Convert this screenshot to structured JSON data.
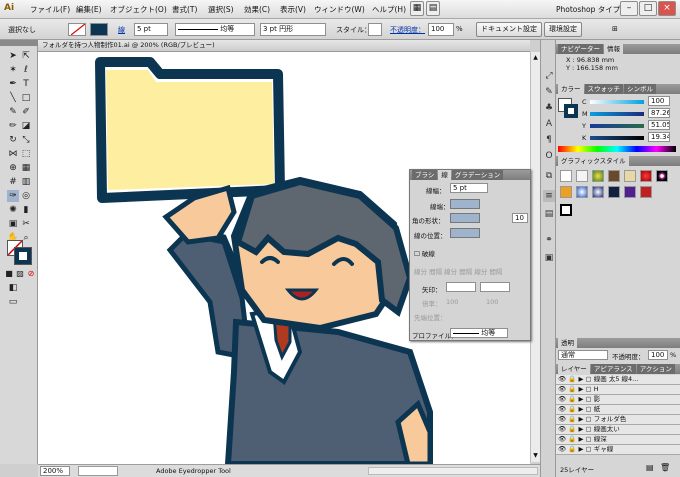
{
  "app": {
    "logo": "Ai",
    "workspace": "Photoshop タイプ"
  },
  "menu": [
    "ファイル(F)",
    "編集(E)",
    "オブジェクト(O)",
    "書式(T)",
    "選択(S)",
    "効果(C)",
    "表示(V)",
    "ウィンドウ(W)",
    "ヘルプ(H)"
  ],
  "control": {
    "selection": "選択なし",
    "stroke_label": "線",
    "stroke_value": "5 pt",
    "profile_label": "均等",
    "brush_value": "3 pt 円形",
    "style_label": "スタイル：",
    "opacity_label": "不透明度：",
    "opacity_value": "100",
    "opacity_unit": "%",
    "doc_settings": "ドキュメント設定",
    "env_settings": "環境設定"
  },
  "document": {
    "tab_title": "フォルダを持つ人物制作01.ai @ 200% (RGB/プレビュー)",
    "zoom": "200%",
    "status_tool": "Adobe Eyedropper Tool"
  },
  "navigator": {
    "tabs": [
      "ナビゲーター",
      "情報"
    ],
    "x": "X : 96.838 mm",
    "y": "Y : 166.158 mm"
  },
  "color": {
    "tabs": [
      "カラー",
      "スウォッチ",
      "シンボル"
    ],
    "channels": [
      {
        "name": "C",
        "value": "100"
      },
      {
        "name": "M",
        "value": "87.26"
      },
      {
        "name": "Y",
        "value": "51.05"
      },
      {
        "name": "K",
        "value": "19.34"
      }
    ],
    "unit": "%"
  },
  "graphic_styles": {
    "title": "グラフィックスタイル"
  },
  "transparency": {
    "title": "透明",
    "mode": "通常",
    "opacity_label": "不透明度：",
    "opacity_value": "100",
    "unit": "%"
  },
  "layers": {
    "tabs": [
      "レイヤー",
      "アピアランス",
      "アクション"
    ],
    "items": [
      "線画 太5 線4...",
      "H",
      "影",
      "紙",
      "フォルダ色",
      "線画太い",
      "線深",
      "ギャ線"
    ],
    "count": "25レイヤー"
  },
  "stroke_panel": {
    "tabs": [
      "ブラシ",
      "線",
      "グラデーション"
    ],
    "weight_label": "線幅：",
    "weight_value": "5 pt",
    "cap_label": "線端：",
    "corner_label": "角の形状：",
    "limit_value": "10",
    "align_label": "線の位置：",
    "dash_label": "破線",
    "dash_fields": [
      "線分",
      "間隔",
      "線分",
      "間隔",
      "線分",
      "間隔"
    ],
    "arrow_label": "矢印：",
    "scale_label": "倍率：",
    "scale_values": [
      "100",
      "100"
    ],
    "scale_unit": "%",
    "align2_label": "先端位置：",
    "profile_label": "プロファイル：",
    "profile_value": "均等"
  },
  "colors": {
    "folder": "#fdeea0",
    "outline": "#0b3551",
    "suit": "#4f5f73",
    "skin": "#f8c99a",
    "hair": "#5e6670",
    "tie": "#b03a20",
    "accent": "#c81818"
  }
}
